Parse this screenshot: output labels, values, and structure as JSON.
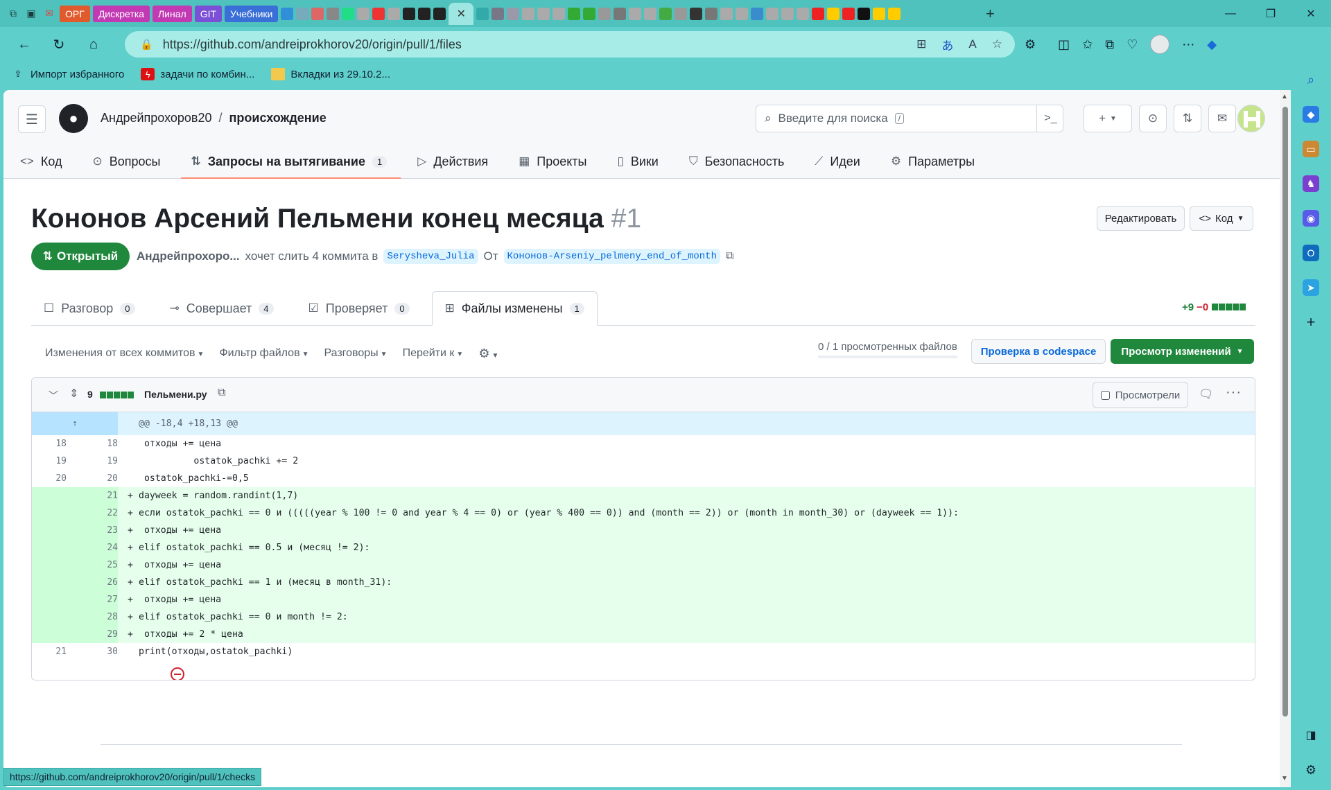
{
  "browser": {
    "tab_chips": [
      {
        "label": "ОРГ",
        "color": "#e05a2b"
      },
      {
        "label": "Дискретка",
        "color": "#c239b3"
      },
      {
        "label": "Линал",
        "color": "#c239b3"
      },
      {
        "label": "GIT",
        "color": "#7b4fd6"
      },
      {
        "label": "Учебники",
        "color": "#3a6fd8"
      }
    ],
    "url": "https://github.com/andreiprokhorov20/origin/pull/1/files",
    "favorites": [
      {
        "label": "Импорт избранного",
        "icon": "import-icon"
      },
      {
        "label": "задачи по комбин...",
        "icon": "red-logo-icon"
      },
      {
        "label": "Вкладки из 29.10.2...",
        "icon": "folder-icon"
      }
    ],
    "status_url": "https://github.com/andreiprokhorov20/origin/pull/1/checks"
  },
  "header": {
    "owner": "Андрейпрохоров20",
    "separator": "/",
    "repo": "происхождение",
    "search_placeholder": "Введите для поиска",
    "search_key": "/"
  },
  "repo_nav": [
    {
      "label": "Код",
      "icon": "code-icon",
      "icon_glyph": "<>"
    },
    {
      "label": "Вопросы",
      "icon": "issue-icon",
      "icon_glyph": "⊙"
    },
    {
      "label": "Запросы на вытягивание",
      "icon": "pull-request-icon",
      "icon_glyph": "⇅",
      "count": "1",
      "selected": true
    },
    {
      "label": "Действия",
      "icon": "play-icon",
      "icon_glyph": "▷"
    },
    {
      "label": "Проекты",
      "icon": "table-icon",
      "icon_glyph": "▦"
    },
    {
      "label": "Вики",
      "icon": "book-icon",
      "icon_glyph": "▯"
    },
    {
      "label": "Безопасность",
      "icon": "shield-icon",
      "icon_glyph": "⛉"
    },
    {
      "label": "Идеи",
      "icon": "graph-icon",
      "icon_glyph": "⟋"
    },
    {
      "label": "Параметры",
      "icon": "gear-icon",
      "icon_glyph": "⚙"
    }
  ],
  "pr": {
    "title": "Кононов Арсений Пельмени конец месяца",
    "number": "#1",
    "edit_label": "Редактировать",
    "code_label": "Код",
    "state": "Открытый",
    "author": "Андрейпрохоро...",
    "action_text": "хочет слить 4 коммита в",
    "base_branch": "Serysheva_Julia",
    "from_text": "От",
    "head_branch": "Кононов-Arseniy_pelmeny_end_of_month"
  },
  "pr_tabs": [
    {
      "label": "Разговор",
      "count": "0",
      "icon": "comment-icon",
      "icon_glyph": "☐"
    },
    {
      "label": "Совершает",
      "count": "4",
      "icon": "commit-icon",
      "icon_glyph": "⊸"
    },
    {
      "label": "Проверяет",
      "count": "0",
      "icon": "checklist-icon",
      "icon_glyph": "☑"
    },
    {
      "label": "Файлы изменены",
      "count": "1",
      "icon": "file-diff-icon",
      "icon_glyph": "⊞",
      "active": true
    }
  ],
  "diffstat": {
    "additions": "+9",
    "deletions": "−0"
  },
  "toolbar": {
    "changes_from": "Изменения от всех коммитов",
    "file_filter": "Фильтр файлов",
    "conversations": "Разговоры",
    "jump_to": "Перейти к",
    "viewed_count": "0 / 1 просмотренных файлов",
    "codespace_label": "Проверка в codespace",
    "review_label": "Просмотр изменений"
  },
  "file": {
    "change_count": "9",
    "name": "Пельмени.ру",
    "viewed_label": "Просмотрели",
    "hunk_header": "@@ -18,4 +18,13 @@",
    "lines": [
      {
        "old": "18",
        "new": "18",
        "type": "context",
        "code": " отходы += цена"
      },
      {
        "old": "19",
        "new": "19",
        "type": "context",
        "code": "          ostatok_pachki += 2"
      },
      {
        "old": "20",
        "new": "20",
        "type": "context",
        "code": " ostatok_pachki-=0,5"
      },
      {
        "old": "",
        "new": "21",
        "type": "add",
        "code": "dayweek = random.randint(1,7)"
      },
      {
        "old": "",
        "new": "22",
        "type": "add",
        "code": "если ostatok_pachki == 0 и (((((year % 100 != 0 and year % 4 == 0) or (year % 400 == 0)) and (month == 2)) or (month in month_30) or (dayweek == 1)):"
      },
      {
        "old": "",
        "new": "23",
        "type": "add",
        "code": " отходы += цена"
      },
      {
        "old": "",
        "new": "24",
        "type": "add",
        "code": "elif ostatok_pachki == 0.5 и (месяц != 2):"
      },
      {
        "old": "",
        "new": "25",
        "type": "add",
        "code": " отходы += цена"
      },
      {
        "old": "",
        "new": "26",
        "type": "add",
        "code": "elif ostatok_pachki == 1 и (месяц в month_31):"
      },
      {
        "old": "",
        "new": "27",
        "type": "add",
        "code": " отходы += цена"
      },
      {
        "old": "",
        "new": "28",
        "type": "add",
        "code": "elif ostatok_pachki == 0 и month != 2:"
      },
      {
        "old": "",
        "new": "29",
        "type": "add",
        "code": " отходы += 2 * цена"
      },
      {
        "old": "21",
        "new": "30",
        "type": "context",
        "code": "print(отходы,ostatok_pachki)"
      }
    ]
  }
}
